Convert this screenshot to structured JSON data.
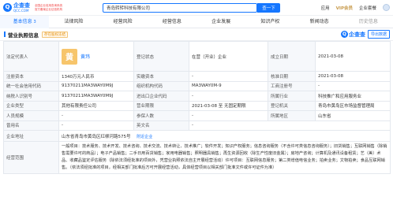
{
  "header": {
    "logo_text": "企查查",
    "logo_sub": "QCC.COM",
    "slogan_line1": "全国企业信用查询系统",
    "slogan_line2": "官方备案企业征信机构",
    "search_value": "青岛转转科技有限公司",
    "search_button": "查一下",
    "nav": [
      "应用",
      "VIP会员",
      "企业套餐"
    ],
    "brand_color": "#1677ff"
  },
  "tabs": [
    {
      "label": "基本信息",
      "count": "3"
    },
    {
      "label": "法律风险",
      "count": ""
    },
    {
      "label": "经营风险",
      "count": ""
    },
    {
      "label": "经营信息",
      "count": ""
    },
    {
      "label": "企业发展",
      "count": ""
    },
    {
      "label": "知识产权",
      "count": ""
    },
    {
      "label": "新闻动态",
      "count": ""
    },
    {
      "label": "历史信息",
      "count": ""
    }
  ],
  "section": {
    "title": "营业执照信息",
    "badge": "存在股权冻结",
    "brand": "企查查",
    "export_label": "导出数据"
  },
  "info": {
    "legal_rep_label": "法定代表人",
    "legal_avatar": "黄",
    "legal_name": "黄玮",
    "reg_status_label": "登记状态",
    "reg_status_value": "在营（开业）企业",
    "established_label": "成立日期",
    "established_value": "2021-03-08",
    "reg_capital_label": "注册资本",
    "reg_capital_value": "1340万元人民币",
    "paid_capital_label": "实缴资本",
    "paid_capital_value": "-",
    "approved_date_label": "核准日期",
    "approved_date_value": "2021-03-08",
    "credit_code_label": "统一社会信用代码",
    "credit_code_value": "91370211MA3WAY0M9J",
    "org_code_label": "组织机构代码",
    "org_code_value": "MA3WAY0M-9",
    "reg_no_label": "工商注册号",
    "reg_no_value": "-",
    "tax_id_label": "纳税人识别号",
    "tax_id_value": "91370211MA3WAY0M9J",
    "import_export_label": "进出口企业代码",
    "import_export_value": "-",
    "industry_label": "所属行业",
    "industry_value": "科技推广和应用服务业",
    "company_type_label": "企业类型",
    "company_type_value": "其他有限责任公司",
    "term_label": "营业期限",
    "term_value": "2021-03-08 至 无固定期限",
    "authority_label": "登记机关",
    "authority_value": "青岛市黄岛区市场监督管理局",
    "staff_label": "人员规模",
    "staff_value": "-",
    "insured_label": "参保人数",
    "insured_value": "-",
    "region_label": "所属地区",
    "region_value": "山东省",
    "former_name_label": "曾用名",
    "former_name_value": "-",
    "en_name_label": "英文名",
    "en_name_value": "-",
    "address_label": "企业地址",
    "address_value": "山东省青岛市黄岛区红柳河路575号",
    "address_link": "附近企业",
    "scope_label": "经营范围",
    "scope_value": "一般项目：技术服务、技术开发、技术咨询、技术交流、技术转让、技术推广；软件开发；知识产权服务；信息咨询服务（不含许可类信息咨询服务）；旧货销售；互联网销售（除销售需要许可的商品）；电子产品销售；二手日用百货销售；家用电器销售；照明器具销售；再生资源回收（除生产性废旧金属）；房地产咨询；计算机及通讯设备租赁；艺（美）术品、收藏品鉴定评估服务（除依法须经批准的项目外，凭营业执照依法自主开展经营活动）许可项目：互联网信息服务；第二类增值电信业务；拍卖业务；文物拍卖；食品互联网销售。（依法须经批准的项目，经相关部门批准后方可开展经营活动，具体经营项目以相关部门批准文件或许可证件为准）"
  }
}
